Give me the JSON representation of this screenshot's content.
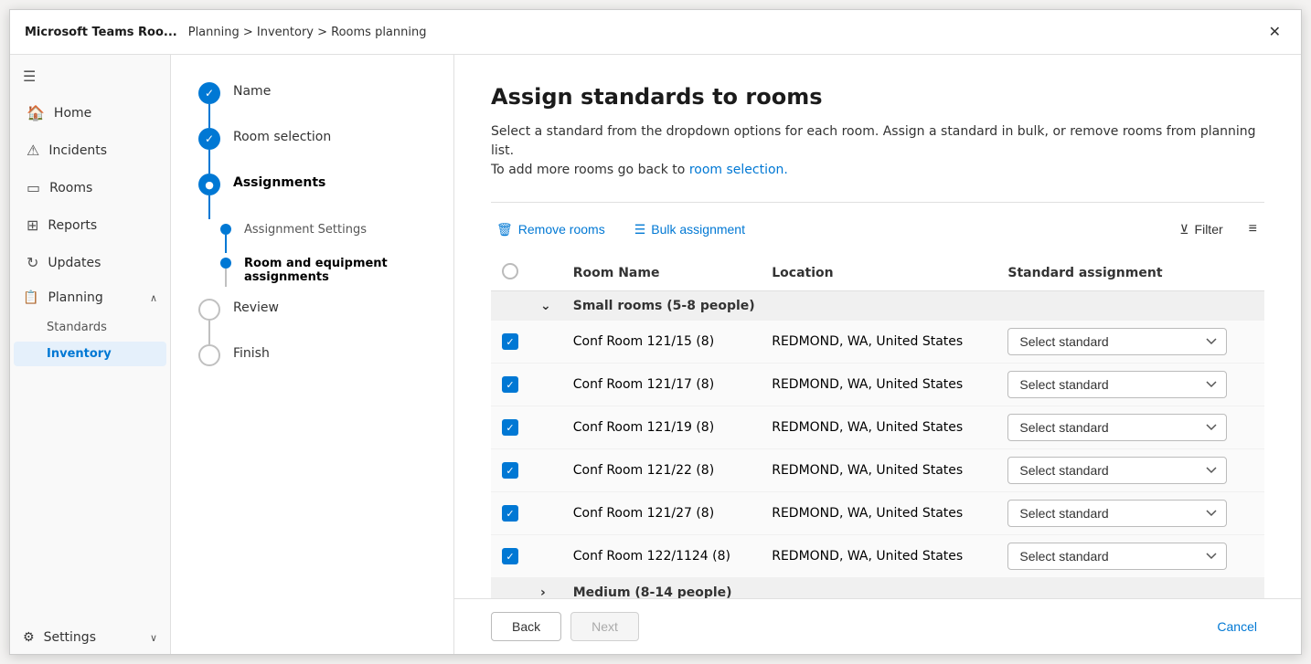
{
  "window": {
    "app_name": "Microsoft Teams Roo...",
    "breadcrumb": "Planning > Inventory > Rooms planning",
    "close_label": "✕"
  },
  "sidebar": {
    "menu_icon": "☰",
    "items": [
      {
        "id": "home",
        "icon": "⌂",
        "label": "Home"
      },
      {
        "id": "incidents",
        "icon": "⚠",
        "label": "Incidents"
      },
      {
        "id": "rooms",
        "icon": "▭",
        "label": "Rooms"
      },
      {
        "id": "reports",
        "icon": "▦",
        "label": "Reports"
      },
      {
        "id": "updates",
        "icon": "↺",
        "label": "Updates"
      },
      {
        "id": "planning",
        "icon": "📋",
        "label": "Planning",
        "has_chevron": true
      }
    ],
    "sub_items": [
      {
        "id": "standards",
        "label": "Standards"
      },
      {
        "id": "inventory",
        "label": "Inventory",
        "active": true
      }
    ],
    "settings": {
      "icon": "⚙",
      "label": "Settings",
      "has_chevron": true
    }
  },
  "wizard": {
    "steps": [
      {
        "id": "name",
        "label": "Name",
        "state": "completed"
      },
      {
        "id": "room_selection",
        "label": "Room selection",
        "state": "completed"
      },
      {
        "id": "assignments",
        "label": "Assignments",
        "state": "active"
      },
      {
        "id": "assignment_settings",
        "label": "Assignment Settings",
        "state": "sub_completed"
      },
      {
        "id": "room_equipment",
        "label": "Room and equipment assignments",
        "state": "sub_active"
      },
      {
        "id": "review",
        "label": "Review",
        "state": "inactive"
      },
      {
        "id": "finish",
        "label": "Finish",
        "state": "inactive"
      }
    ]
  },
  "content": {
    "title": "Assign standards to rooms",
    "description_1": "Select a standard from the dropdown options for each room. Assign a standard in bulk, or remove rooms from planning list.",
    "description_2": "To add more rooms go back to",
    "link_text": "room selection.",
    "toolbar": {
      "remove_rooms": "Remove rooms",
      "bulk_assignment": "Bulk assignment",
      "filter": "Filter",
      "sort_icon": "sort"
    },
    "table": {
      "headers": [
        "",
        "",
        "Room Name",
        "Location",
        "Standard assignment"
      ],
      "groups": [
        {
          "id": "small",
          "label": "Small rooms (5-8 people)",
          "expanded": true,
          "rooms": [
            {
              "name": "Conf Room 121/15 (8)",
              "location": "REDMOND, WA, United States",
              "standard": "Select standard"
            },
            {
              "name": "Conf Room 121/17 (8)",
              "location": "REDMOND, WA, United States",
              "standard": "Select standard"
            },
            {
              "name": "Conf Room 121/19 (8)",
              "location": "REDMOND, WA, United States",
              "standard": "Select standard"
            },
            {
              "name": "Conf Room 121/22 (8)",
              "location": "REDMOND, WA, United States",
              "standard": "Select standard"
            },
            {
              "name": "Conf Room 121/27 (8)",
              "location": "REDMOND, WA, United States",
              "standard": "Select standard"
            },
            {
              "name": "Conf Room 122/1124 (8)",
              "location": "REDMOND, WA, United States",
              "standard": "Select standard"
            }
          ]
        },
        {
          "id": "medium",
          "label": "Medium (8-14 people)",
          "expanded": false,
          "rooms": []
        }
      ]
    },
    "footer": {
      "back_label": "Back",
      "next_label": "Next",
      "cancel_label": "Cancel"
    }
  }
}
